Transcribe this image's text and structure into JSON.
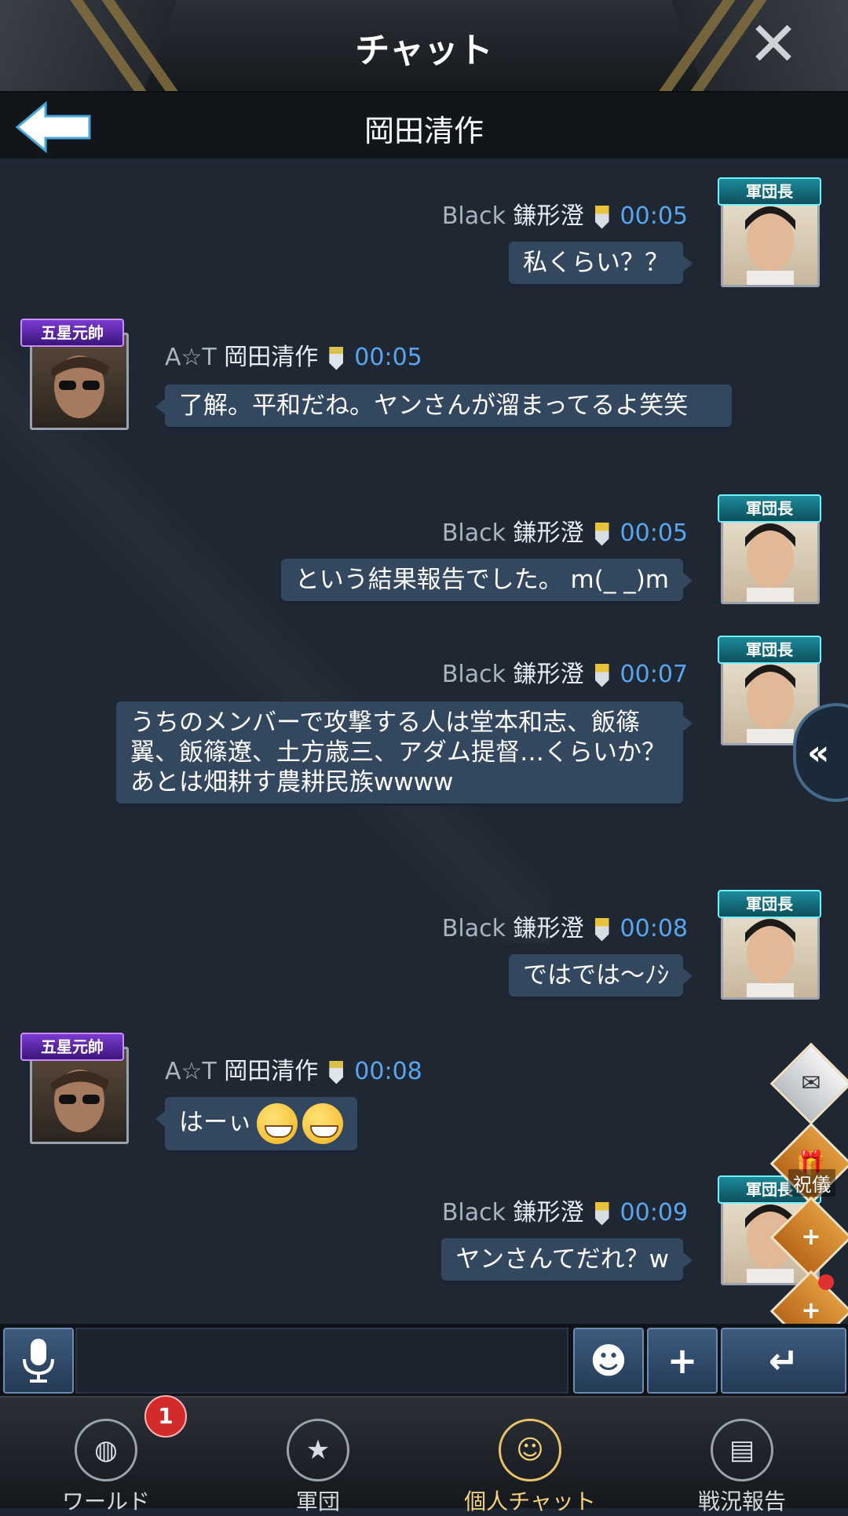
{
  "header": {
    "title": "チャット",
    "close_icon": "close-icon"
  },
  "subheader": {
    "back_icon": "back-arrow-icon",
    "title": "岡田清作"
  },
  "messages": [
    {
      "side": "right",
      "prefix": "Black",
      "name": "鎌形澄",
      "time": "00:05",
      "rank": "軍団長",
      "text": "私くらい？？"
    },
    {
      "side": "left",
      "prefix": "A☆T",
      "name": "岡田清作",
      "time": "00:05",
      "rank": "五星元帥",
      "text": "了解。平和だね。ヤンさんが溜まってるよ笑笑"
    },
    {
      "side": "right",
      "prefix": "Black",
      "name": "鎌形澄",
      "time": "00:05",
      "rank": "軍団長",
      "text": "という結果報告でした。 m(_ _)m"
    },
    {
      "side": "right",
      "prefix": "Black",
      "name": "鎌形澄",
      "time": "00:07",
      "rank": "軍団長",
      "text": "うちのメンバーで攻撃する人は堂本和志、飯篠翼、飯篠遼、土方歳三、アダム提督…くらいか？あとは畑耕す農耕民族wwww"
    },
    {
      "side": "right",
      "prefix": "Black",
      "name": "鎌形澄",
      "time": "00:08",
      "rank": "軍団長",
      "text": "ではでは～ﾉｼ"
    },
    {
      "side": "left",
      "prefix": "A☆T",
      "name": "岡田清作",
      "time": "00:08",
      "rank": "五星元帥",
      "text": "はーぃ"
    },
    {
      "side": "right",
      "prefix": "Black",
      "name": "鎌形澄",
      "time": "00:09",
      "rank": "軍団長",
      "text": "ヤンさんてだれ？w"
    }
  ],
  "side_buttons": {
    "mail_icon": "mail-icon",
    "gift_label": "祝儀",
    "add_friend_icon": "add-friend-icon",
    "alliance_icon": "handshake-plus-icon",
    "collapse_icon": "double-chevron-left-icon"
  },
  "input_bar": {
    "mic_icon": "microphone-icon",
    "placeholder": "",
    "emoji_icon": "smiley-icon",
    "plus_icon": "plus-icon",
    "send_icon": "enter-icon"
  },
  "nav": {
    "items": [
      {
        "label": "ワールド",
        "icon": "globe-chat-icon",
        "badge": "1"
      },
      {
        "label": "軍団",
        "icon": "legion-star-icon"
      },
      {
        "label": "個人チャット",
        "icon": "personal-chat-icon",
        "active": true
      },
      {
        "label": "戦況報告",
        "icon": "report-clipboard-icon"
      }
    ]
  },
  "colors": {
    "bubble": "#33475f",
    "time": "#5aa6ee",
    "active_nav": "#f2d27a",
    "badge": "#d22b2b"
  }
}
